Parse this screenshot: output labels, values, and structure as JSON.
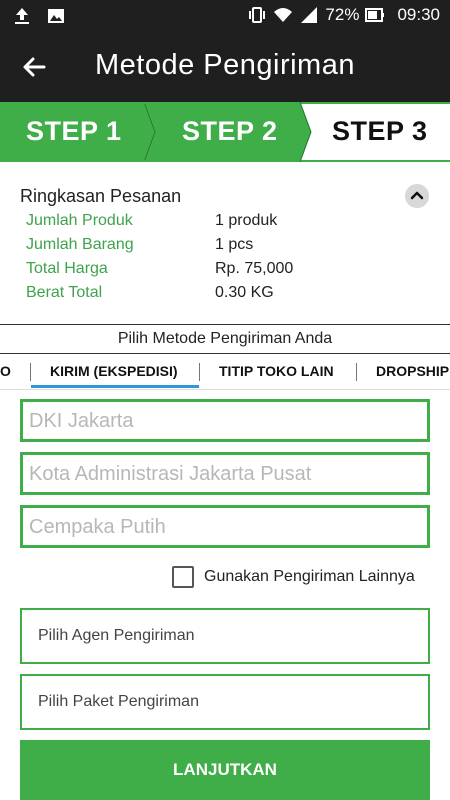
{
  "status_bar": {
    "battery_percent": "72%",
    "time": "09:30",
    "icons_left": [
      "upload-icon",
      "image-icon"
    ],
    "icons_right": [
      "vibrate-icon",
      "wifi-icon",
      "signal-icon",
      "battery-icon"
    ]
  },
  "app_bar": {
    "title": "Metode Pengiriman",
    "back_icon": "arrow-left-icon"
  },
  "steps": [
    {
      "label": "STEP 1",
      "state": "done"
    },
    {
      "label": "STEP 2",
      "state": "done"
    },
    {
      "label": "STEP 3",
      "state": "current"
    }
  ],
  "summary": {
    "title": "Ringkasan Pesanan",
    "collapse_icon": "chevron-up-icon",
    "rows": [
      {
        "label": "Jumlah Produk",
        "value": "1 produk"
      },
      {
        "label": "Jumlah Barang",
        "value": "1 pcs"
      },
      {
        "label": "Total Harga",
        "value": "Rp. 75,000"
      },
      {
        "label": "Berat Total",
        "value": "0.30 KG"
      }
    ]
  },
  "method": {
    "title": "Pilih Metode Pengiriman Anda",
    "tabs": [
      {
        "label": "O"
      },
      {
        "label": "KIRIM (EKSPEDISI)",
        "active": true
      },
      {
        "label": "TITIP TOKO LAIN"
      },
      {
        "label": "DROPSHIP"
      }
    ]
  },
  "form": {
    "province_placeholder": "DKI Jakarta",
    "city_placeholder": "Kota Administrasi Jakarta Pusat",
    "district_placeholder": "Cempaka Putih",
    "other_shipping_label": "Gunakan Pengiriman Lainnya",
    "agent_placeholder": "Pilih Agen Pengiriman",
    "package_placeholder": "Pilih Paket Pengiriman",
    "submit_label": "LANJUTKAN"
  },
  "colors": {
    "accent_green": "#3fae49",
    "label_green": "#3fa34d",
    "tab_indicator": "#2d97d7",
    "bar_dark": "#1f1f1f"
  }
}
